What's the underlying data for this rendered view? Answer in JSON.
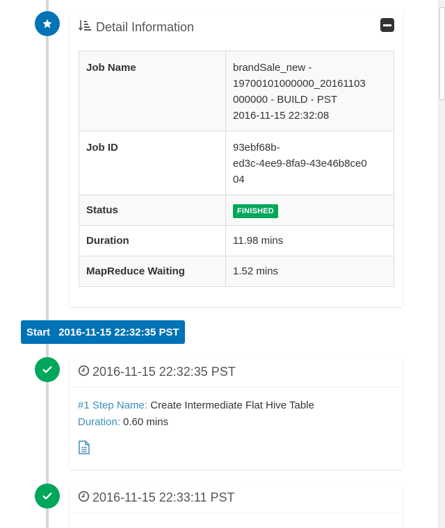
{
  "detail": {
    "title": "Detail Information",
    "rows": [
      {
        "label": "Job Name",
        "value": "brandSale_new -\n19700101000000_20161103\n000000 - BUILD - PST\n2016-11-15 22:32:08"
      },
      {
        "label": "Job ID",
        "value": "93ebf68b-\ned3c-4ee9-8fa9-43e46b8ce0\n04"
      },
      {
        "label": "Status",
        "value": "FINISHED"
      },
      {
        "label": "Duration",
        "value": "11.98 mins"
      },
      {
        "label": "MapReduce Waiting",
        "value": "1.52 mins"
      }
    ]
  },
  "start": {
    "label": "Start",
    "time": "2016-11-15 22:32:35 PST"
  },
  "steps": [
    {
      "time": "2016-11-15 22:32:35 PST",
      "name_key": "#1 Step Name:",
      "name_value": "Create Intermediate Flat Hive Table",
      "duration_key": "Duration:",
      "duration_value": "0.60 mins"
    },
    {
      "time": "2016-11-15 22:33:11 PST"
    }
  ],
  "colors": {
    "primary": "#0073b7",
    "success": "#00a65a",
    "link": "#3c8dbc"
  }
}
